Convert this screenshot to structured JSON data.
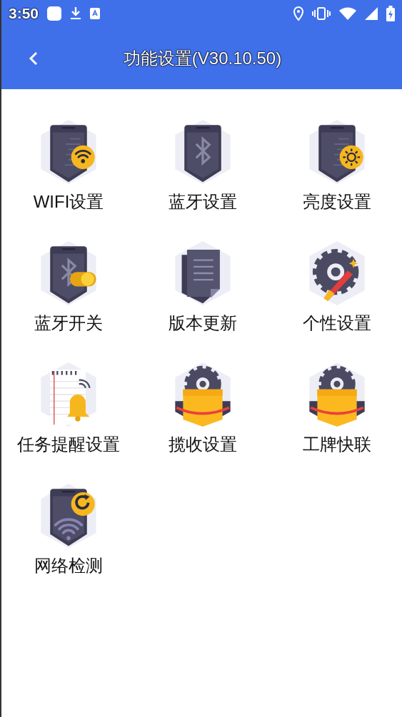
{
  "status_bar": {
    "time": "3:50"
  },
  "app_bar": {
    "title": "功能设置(V30.10.50)"
  },
  "items": [
    {
      "label": "WIFI设置",
      "kind": "wifi"
    },
    {
      "label": "蓝牙设置",
      "kind": "bluetooth"
    },
    {
      "label": "亮度设置",
      "kind": "brightness"
    },
    {
      "label": "蓝牙开关",
      "kind": "toggle"
    },
    {
      "label": "版本更新",
      "kind": "document"
    },
    {
      "label": "个性设置",
      "kind": "gear"
    },
    {
      "label": "任务提醒设置",
      "kind": "reminder"
    },
    {
      "label": "揽收设置",
      "kind": "box"
    },
    {
      "label": "工牌快联",
      "kind": "box"
    },
    {
      "label": "网络检测",
      "kind": "network"
    }
  ]
}
